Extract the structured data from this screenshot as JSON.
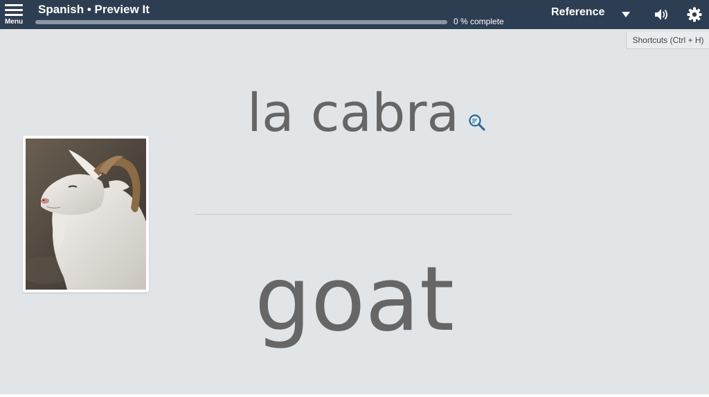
{
  "header": {
    "menu_label": "Menu",
    "title": "Spanish • Preview It",
    "progress_percent": 0,
    "progress_text": "0 % complete",
    "reference_label": "Reference"
  },
  "shortcuts": {
    "label": "Shortcuts  (Ctrl + H)"
  },
  "card": {
    "prompt": "la cabra",
    "answer": "goat"
  },
  "colors": {
    "topbar": "#2e3e52",
    "background": "#e1e5e8",
    "word_text": "#666666",
    "magnifier": "#2f6d9b"
  }
}
